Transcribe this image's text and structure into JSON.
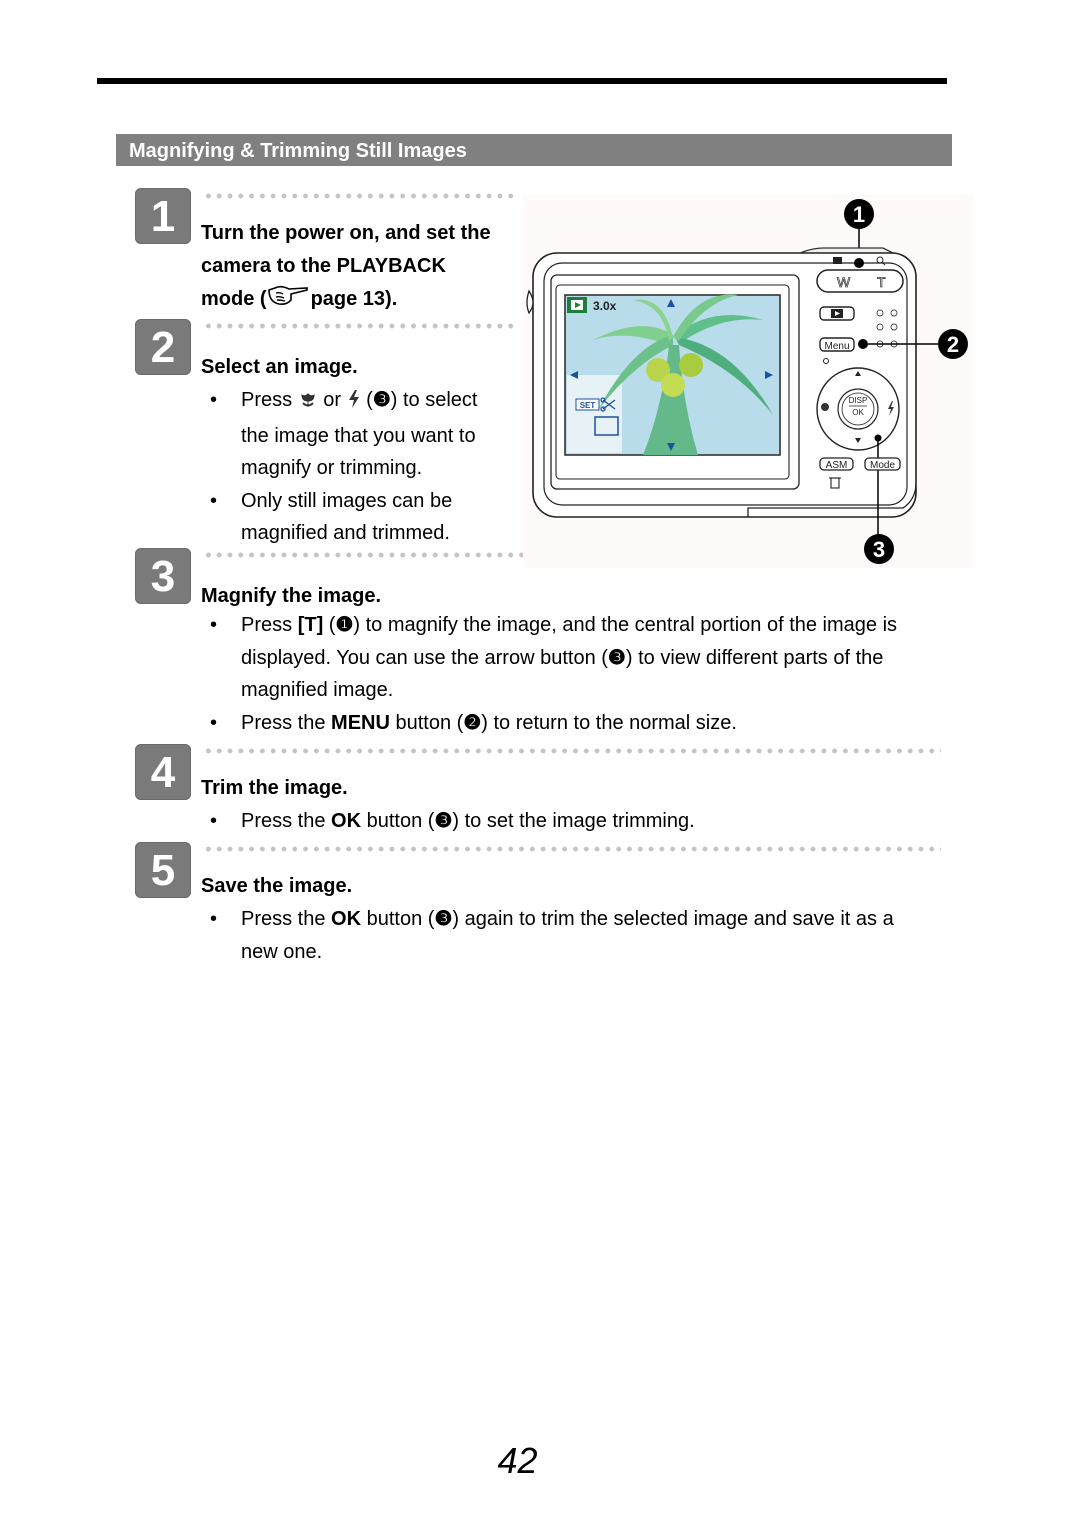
{
  "section": {
    "title": "Magnifying & Trimming Still Images"
  },
  "steps": [
    {
      "number": "1",
      "heading_lines": [
        "Turn the power on, and set the",
        "camera to the PLAYBACK"
      ],
      "heading_ref_prefix": "mode (",
      "heading_ref_icon": "pointing-hand-icon",
      "heading_ref_suffix": "page 13)."
    },
    {
      "number": "2",
      "heading": "Select an image.",
      "bullets": [
        {
          "parts": [
            "Press ",
            "macro-icon",
            " or ",
            "flash-icon",
            " (",
            "❸",
            ") to select"
          ],
          "lines": [
            "the image that you want to",
            "magnify or trimming."
          ]
        },
        {
          "lines": [
            "Only still images can be",
            "magnified and trimmed."
          ]
        }
      ]
    },
    {
      "number": "3",
      "heading": "Magnify the image.",
      "bullets": [
        {
          "pre": "Press ",
          "bold": "[T]",
          "ref": "❶",
          "line1_rest": ") to magnify the image, and the central portion of the image is",
          "line2_pre": "displayed. You can use the arrow button (",
          "line2_ref": "❸",
          "line2_rest": ") to view different parts of the",
          "line3": "magnified image."
        },
        {
          "pre": "Press the ",
          "bold": "MENU",
          "mid": " button (",
          "ref": "❷",
          "rest": ") to return to the normal size."
        }
      ]
    },
    {
      "number": "4",
      "heading": "Trim the image.",
      "bullets": [
        {
          "pre": "Press the ",
          "bold": "OK",
          "mid": " button (",
          "ref": "❸",
          "rest": ") to set the image trimming."
        }
      ]
    },
    {
      "number": "5",
      "heading": "Save the image.",
      "bullets": [
        {
          "pre": "Press the ",
          "bold": "OK",
          "mid": " button (",
          "ref": "❸",
          "rest": ") again to trim the selected image and save it as a",
          "line2": "new one."
        }
      ]
    }
  ],
  "illustration": {
    "callouts": [
      "1",
      "2",
      "3"
    ],
    "screen": {
      "zoom_label": "3.0x",
      "set_label": "SET",
      "colors": {
        "sky": "#b8dcea",
        "leaf": "#5fbf8a",
        "play_badge": "#1e7f3a",
        "arrow": "#1f4fa0"
      }
    },
    "buttons": {
      "wide": "W",
      "tele": "T",
      "menu": "Menu",
      "disp": "DISP",
      "ok": "OK",
      "asm": "ASM",
      "mode": "Mode"
    }
  },
  "page_number": "42"
}
